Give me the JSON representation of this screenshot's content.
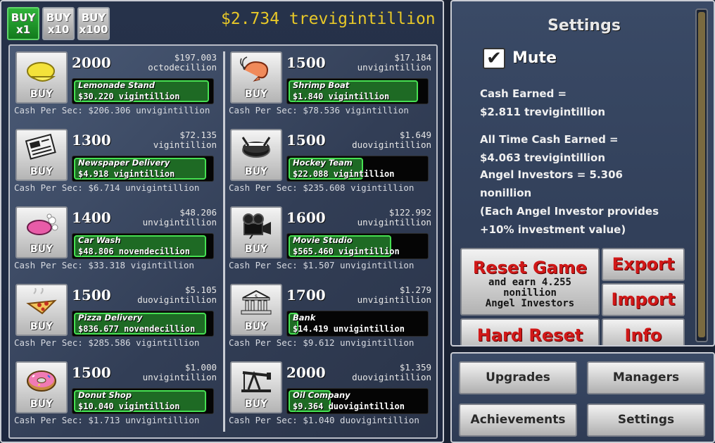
{
  "buy_multipliers": [
    {
      "line1": "BUY",
      "line2": "x1",
      "active": true
    },
    {
      "line1": "BUY",
      "line2": "x10",
      "active": false
    },
    {
      "line1": "BUY",
      "line2": "x100",
      "active": false
    }
  ],
  "cash_total": "$2.734 trevigintillion",
  "buy_label": "BUY",
  "businesses": [
    {
      "name": "Lemonade Stand",
      "count": "2000",
      "cost_amount": "$197.003",
      "cost_unit": "octodecillion",
      "revenue": "$30.220 vigintillion",
      "cps": "Cash Per Sec: $206.306 unvigintillion",
      "progress": 0.98,
      "icon": "lemon-icon"
    },
    {
      "name": "Newspaper Delivery",
      "count": "1300",
      "cost_amount": "$72.135",
      "cost_unit": "vigintillion",
      "revenue": "$4.918 vigintillion",
      "cps": "Cash Per Sec: $6.714 unvigintillion",
      "progress": 0.96,
      "icon": "newspaper-icon"
    },
    {
      "name": "Car Wash",
      "count": "1400",
      "cost_amount": "$48.206",
      "cost_unit": "unvigintillion",
      "revenue": "$48.806 novendecillion",
      "cps": "Cash Per Sec: $33.318 vigintillion",
      "progress": 0.96,
      "icon": "soap-icon"
    },
    {
      "name": "Pizza Delivery",
      "count": "1500",
      "cost_amount": "$5.105",
      "cost_unit": "duovigintillion",
      "revenue": "$836.677 novendecillion",
      "cps": "Cash Per Sec: $285.586 vigintillion",
      "progress": 0.96,
      "icon": "pizza-icon"
    },
    {
      "name": "Donut Shop",
      "count": "1500",
      "cost_amount": "$1.000",
      "cost_unit": "unvigintillion",
      "revenue": "$10.040 vigintillion",
      "cps": "Cash Per Sec: $1.713 unvigintillion",
      "progress": 0.96,
      "icon": "donut-icon"
    },
    {
      "name": "Shrimp Boat",
      "count": "1500",
      "cost_amount": "$17.184",
      "cost_unit": "unvigintillion",
      "revenue": "$1.840 vigintillion",
      "cps": "Cash Per Sec: $78.536 vigintillion",
      "progress": 0.94,
      "icon": "shrimp-icon"
    },
    {
      "name": "Hockey Team",
      "count": "1500",
      "cost_amount": "$1.649",
      "cost_unit": "duovigintillion",
      "revenue": "$22.088 vigintillion",
      "cps": "Cash Per Sec: $235.608 vigintillion",
      "progress": 0.55,
      "icon": "hockey-icon"
    },
    {
      "name": "Movie Studio",
      "count": "1600",
      "cost_amount": "$122.992",
      "cost_unit": "unvigintillion",
      "revenue": "$565.460 vigintillion",
      "cps": "Cash Per Sec: $1.507 unvigintillion",
      "progress": 0.75,
      "icon": "camera-icon"
    },
    {
      "name": "Bank",
      "count": "1700",
      "cost_amount": "$1.279",
      "cost_unit": "unvigintillion",
      "revenue": "$14.419 unvigintillion",
      "cps": "Cash Per Sec: $9.612 unvigintillion",
      "progress": 0.09,
      "icon": "bank-icon"
    },
    {
      "name": "Oil Company",
      "count": "2000",
      "cost_amount": "$1.359",
      "cost_unit": "duovigintillion",
      "revenue": "$9.364 duovigintillion",
      "cps": "Cash Per Sec: $1.040 duovigintillion",
      "progress": 0.32,
      "icon": "oil-pump-icon"
    }
  ],
  "settings": {
    "title": "Settings",
    "mute_label": "Mute",
    "mute_checked": true,
    "check_glyph": "✔",
    "stats": [
      "Cash Earned =",
      "$2.811 trevigintillion",
      "All Time Cash Earned =",
      "$4.063 trevigintillion",
      "Angel Investors = 5.306",
      "nonillion",
      "(Each Angel Investor provides",
      "+10% investment value)"
    ],
    "reset_game": "Reset Game",
    "reset_sub": [
      "and earn 4.255",
      "nonillion",
      "Angel Investors"
    ],
    "export": "Export",
    "import": "Import",
    "hard_reset": "Hard Reset",
    "info": "Info"
  },
  "nav": {
    "upgrades": "Upgrades",
    "managers": "Managers",
    "achievements": "Achievements",
    "settings": "Settings"
  },
  "colors": {
    "cash_gold": "#e8c828",
    "buy_active": "#1e9a2a",
    "progress_green": "#46e052",
    "danger_red": "#d01818"
  }
}
